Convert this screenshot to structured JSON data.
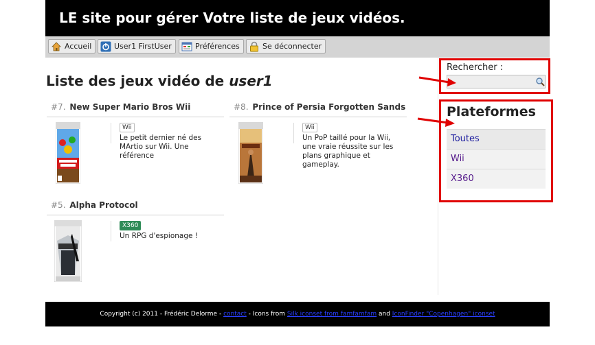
{
  "header": {
    "title": "LE site pour gérer Votre liste de jeux vidéos."
  },
  "nav": {
    "items": [
      {
        "label": "Accueil",
        "icon": "home-icon"
      },
      {
        "label": "User1 FirstUser",
        "icon": "power-icon"
      },
      {
        "label": "Préférences",
        "icon": "preferences-icon"
      },
      {
        "label": "Se déconnecter",
        "icon": "lock-icon"
      }
    ]
  },
  "main": {
    "title_prefix": "Liste des jeux vidéo de ",
    "title_user": "user1",
    "games": [
      {
        "rank": "#7.",
        "name": "New Super Mario Bros Wii",
        "platform": "Wii",
        "description": "Le petit dernier né des MArtio sur Wii. Une référence"
      },
      {
        "rank": "#8.",
        "name": "Prince of Persia Forgotten Sands",
        "platform": "Wii",
        "description": "Un PoP taillé pour la Wii, une vraie réussite sur les plans graphique et gameplay."
      },
      {
        "rank": "#5.",
        "name": "Alpha Protocol",
        "platform": "X360",
        "description": "Un RPG d'espionage !"
      }
    ]
  },
  "sidebar": {
    "search_label": "Rechercher :",
    "search_value": "",
    "platforms_title": "Plateformes",
    "platforms": [
      "Toutes",
      "Wii",
      "X360"
    ]
  },
  "footer": {
    "text_before": "Copyright (c) 2011 - Frédéric Delorme - ",
    "contact": "contact",
    "text_mid": " - Icons from ",
    "link1": "Silk iconset from famfamfam",
    "text_and": " and ",
    "link2": "IconFinder \"Copenhagen\" iconset"
  },
  "colors": {
    "header_bg": "#000000",
    "highlight_border": "#e00000",
    "x360_tag": "#2e8b57"
  }
}
